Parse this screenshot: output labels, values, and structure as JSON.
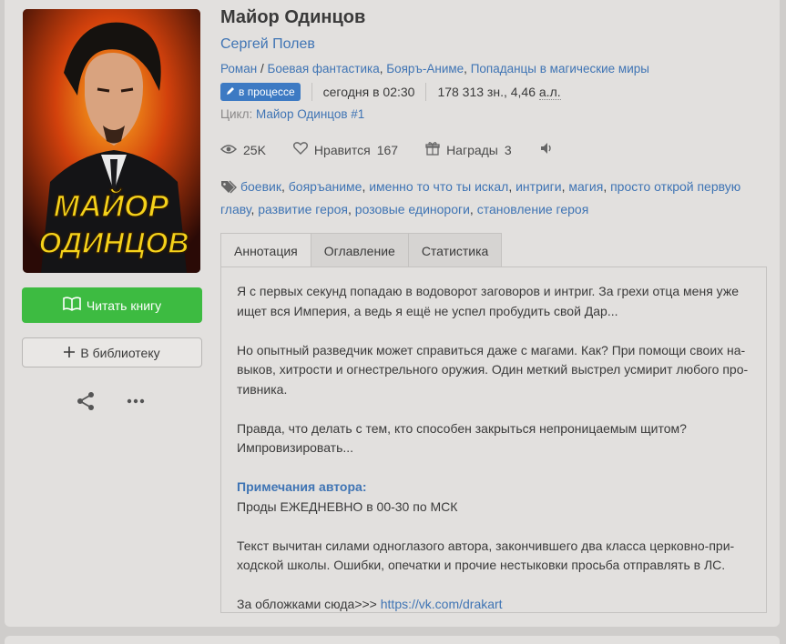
{
  "book": {
    "title": "Майор Одинцов",
    "author": "Сергей Полев",
    "genres": [
      "Роман",
      "Боевая фантастика",
      "Бояръ-Аниме",
      "Попаданцы в магические миры"
    ],
    "genre_sep": "/",
    "status_badge": "в процессе",
    "updated": "сегодня в 02:30",
    "size": "178 313 зн., 4,46 ",
    "size_unit": "а.л.",
    "cycle_label": "Цикл:",
    "cycle_name": "Майор Одинцов #1",
    "cover_text_line1": "МАЙОР",
    "cover_text_line2": "ОДИНЦОВ"
  },
  "actions": {
    "read_label": "Читать книгу",
    "library_label": "В библиотеку",
    "share_icon": "share-icon",
    "more_icon": "more-icon"
  },
  "stats": {
    "views": "25K",
    "likes_label": "Нравится",
    "likes": "167",
    "awards_label": "Награды",
    "awards": "3"
  },
  "tags": [
    "боевик",
    "бояръаниме",
    "именно то что ты искал",
    "интриги",
    "магия",
    "просто открой первую главу",
    "развитие героя",
    "розовые единороги",
    "становление героя"
  ],
  "tabs": [
    {
      "label": "Аннотация",
      "active": true
    },
    {
      "label": "Оглавление",
      "active": false
    },
    {
      "label": "Статистика",
      "active": false
    }
  ],
  "annotation": {
    "p1_l1": "Я с первых секунд попадаю в водоворот заговоров и интриг. За грехи отца меня уже",
    "p1_l2": "ищет вся Империя, а ведь я ещё не успел пробудить свой Дар...",
    "p2_l1": "Но опытный разведчик может справиться даже с магами. Как? При помощи своих на-",
    "p2_l2": "выков, хитрости и огнестрельного оружия. Один меткий выстрел усмирит любого про-",
    "p2_l3": "тивника.",
    "p3_l1": "Правда, что делать с тем, кто способен закрыться непроницаемым щитом?",
    "p3_l2": "Импровизировать...",
    "note_heading": "Примечания автора:",
    "note_l1": "Проды ЕЖЕДНЕВНО в 00-30 по МСК",
    "p4_l1": "Текст вычитан силами одноглазого автора, закончившего два класса церковно-при-",
    "p4_l2": "ходской школы. Ошибки, опечатки и прочие нестыковки просьба отправлять в ЛС.",
    "covers_text": "За обложками сюда>>> ",
    "covers_link": "https://vk.com/drakart"
  },
  "colors": {
    "accent_link": "#3f74b4",
    "read_button": "#3dbb41",
    "badge": "#3d7ac3",
    "panel": "#e2e0de"
  }
}
